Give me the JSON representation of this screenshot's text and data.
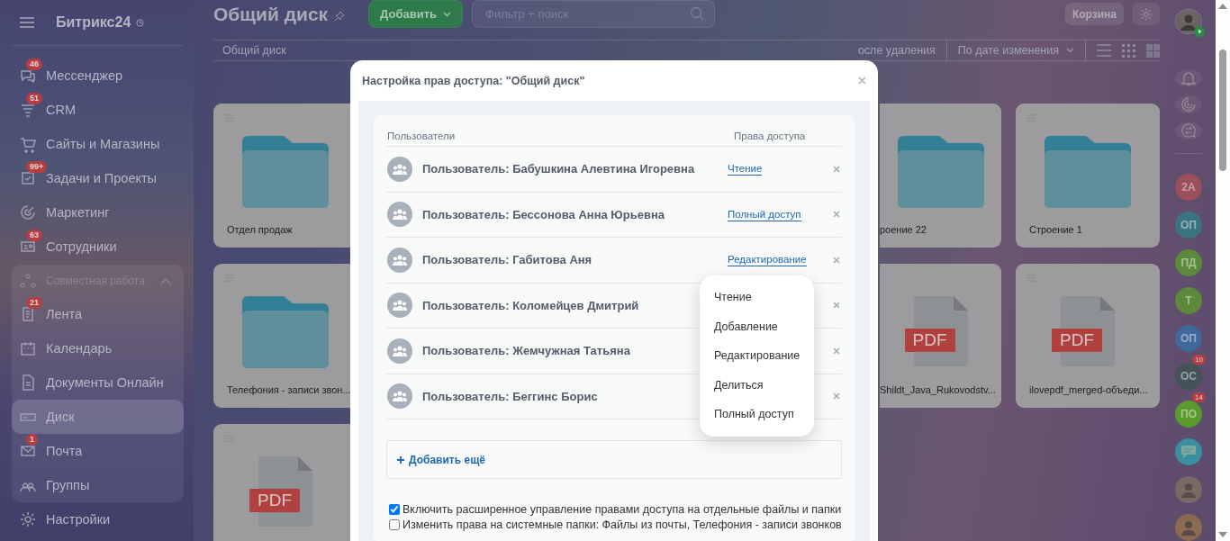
{
  "sidebar": {
    "title": "Битрикс24",
    "items": [
      {
        "label": "Мессенджер",
        "badge": "46",
        "selected": false
      },
      {
        "label": "CRM",
        "badge": "51",
        "selected": false
      },
      {
        "label": "Сайты и Магазины",
        "selected": false
      },
      {
        "label": "Задачи и Проекты",
        "badge": "99+",
        "selected": false
      },
      {
        "label": "Маркетинг",
        "selected": false
      },
      {
        "label": "Сотрудники",
        "badge": "63",
        "selected": false
      }
    ],
    "group": {
      "label": "Совместная работа",
      "expanded": true,
      "items": [
        {
          "label": "Лента",
          "badge": "21",
          "selected": false
        },
        {
          "label": "Календарь",
          "selected": false
        },
        {
          "label": "Документы Онлайн",
          "selected": false
        },
        {
          "label": "Диск",
          "selected": true
        },
        {
          "label": "Почта",
          "badge": "1",
          "selected": false
        },
        {
          "label": "Группы",
          "selected": false
        }
      ]
    },
    "settings": "Настройки"
  },
  "header": {
    "title": "Общий диск",
    "add_button": "Добавить",
    "search": {
      "placeholder": "Фильтр + поиск"
    },
    "trash_button": "Корзина"
  },
  "toolbar": {
    "breadcrumb": "Общий диск",
    "deleted_filter": "осле удаления",
    "sort": "По дате изменения"
  },
  "files": [
    {
      "kind": "folder",
      "name": "Отдел продаж"
    },
    {
      "kind": "folder",
      "name": "роение 22"
    },
    {
      "kind": "folder",
      "name": "Строение 1"
    },
    {
      "kind": "folder",
      "name": "Телефония - записи звон..."
    },
    {
      "kind": "pdf",
      "badge": "PDF",
      "name": "Shildt_Java_Rukovodstv..."
    },
    {
      "kind": "pdf",
      "badge": "PDF",
      "name": "ilovepdf_merged-объеди..."
    },
    {
      "kind": "pdf",
      "badge": "PDF"
    }
  ],
  "rail": {
    "contacts": [
      {
        "kind": "initials",
        "initials": "2А",
        "color": "#9c4f5c"
      },
      {
        "kind": "initials",
        "initials": "ОП",
        "color": "#3a7480"
      },
      {
        "kind": "initials",
        "initials": "ПД",
        "color": "#5c8a3a"
      },
      {
        "kind": "initials",
        "initials": "Т",
        "color": "#5c8a3a"
      },
      {
        "kind": "initials",
        "initials": "ОП",
        "color": "#40699a"
      },
      {
        "kind": "initials",
        "initials": "ОС",
        "color": "#44535a",
        "badge": "10"
      },
      {
        "kind": "initials",
        "initials": "ПО",
        "color": "#5b9a2c",
        "badge": "14"
      },
      {
        "kind": "chat",
        "color": "#3a8fa0"
      },
      {
        "kind": "photo",
        "color": "#7a6a66"
      },
      {
        "kind": "photo",
        "color": "#8a6a50"
      }
    ]
  },
  "dialog": {
    "title": "Настройка прав доступа: \"Общий диск\"",
    "columns": [
      "Пользователи",
      "Права доступа"
    ],
    "rows": [
      {
        "user": "Пользователь: Бабушкина Алевтина Игоревна",
        "access": "Чтение",
        "expanded": false
      },
      {
        "user": "Пользователь: Бессонова Анна Юрьевна",
        "access": "Полный доступ",
        "expanded": false
      },
      {
        "user": "Пользователь: Габитова Аня",
        "access": "Редактирование",
        "expanded": true
      },
      {
        "user": "Пользователь: Коломейцев Дмитрий",
        "expanded": false
      },
      {
        "user": "Пользователь: Жемчужная Татьяна",
        "expanded": false
      },
      {
        "user": "Пользователь: Беггинс Борис",
        "expanded": false
      }
    ],
    "access_options": [
      "Чтение",
      "Добавление",
      "Редактирование",
      "Делиться",
      "Полный доступ"
    ],
    "add_more": "Добавить ещё",
    "options": [
      {
        "label": "Включить расширенное управление правами доступа на отдельные файлы и папки",
        "checked": true
      },
      {
        "label": "Изменить права на системные папки: Файлы из почты, Телефония - записи звонков",
        "checked": false
      }
    ]
  }
}
